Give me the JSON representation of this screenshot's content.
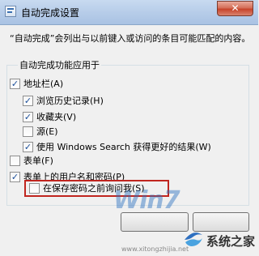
{
  "window": {
    "title": "自动完成设置",
    "close_glyph": "✕"
  },
  "description": "“自动完成”会列出与以前键入或访问的条目可能匹配的内容。",
  "group": {
    "title": "自动完成功能应用于",
    "items": {
      "address_bar": {
        "label": "地址栏(A)",
        "checked": true
      },
      "browse_history": {
        "label": "浏览历史记录(H)",
        "checked": true
      },
      "favorites": {
        "label": "收藏夹(V)",
        "checked": true
      },
      "feeds": {
        "label": "源(E)",
        "checked": false
      },
      "windows_search": {
        "label": "使用 Windows Search 获得更好的结果(W)",
        "checked": true
      },
      "forms": {
        "label": "表单(F)",
        "checked": false
      },
      "usernames_passwords": {
        "label": "表单上的用户名和密码(P)",
        "checked": true
      },
      "ask_before_save": {
        "label": "在保存密码之前询问我(S)",
        "checked": false
      }
    }
  },
  "watermark": {
    "mark": "Win7",
    "site_name": "系统之家",
    "url": "www.xitongzhijia.net"
  },
  "check_glyph": "✓",
  "colors": {
    "title_bar": "#b7cde9",
    "highlight_border": "#c0251f",
    "close_button": "#c7432a"
  }
}
